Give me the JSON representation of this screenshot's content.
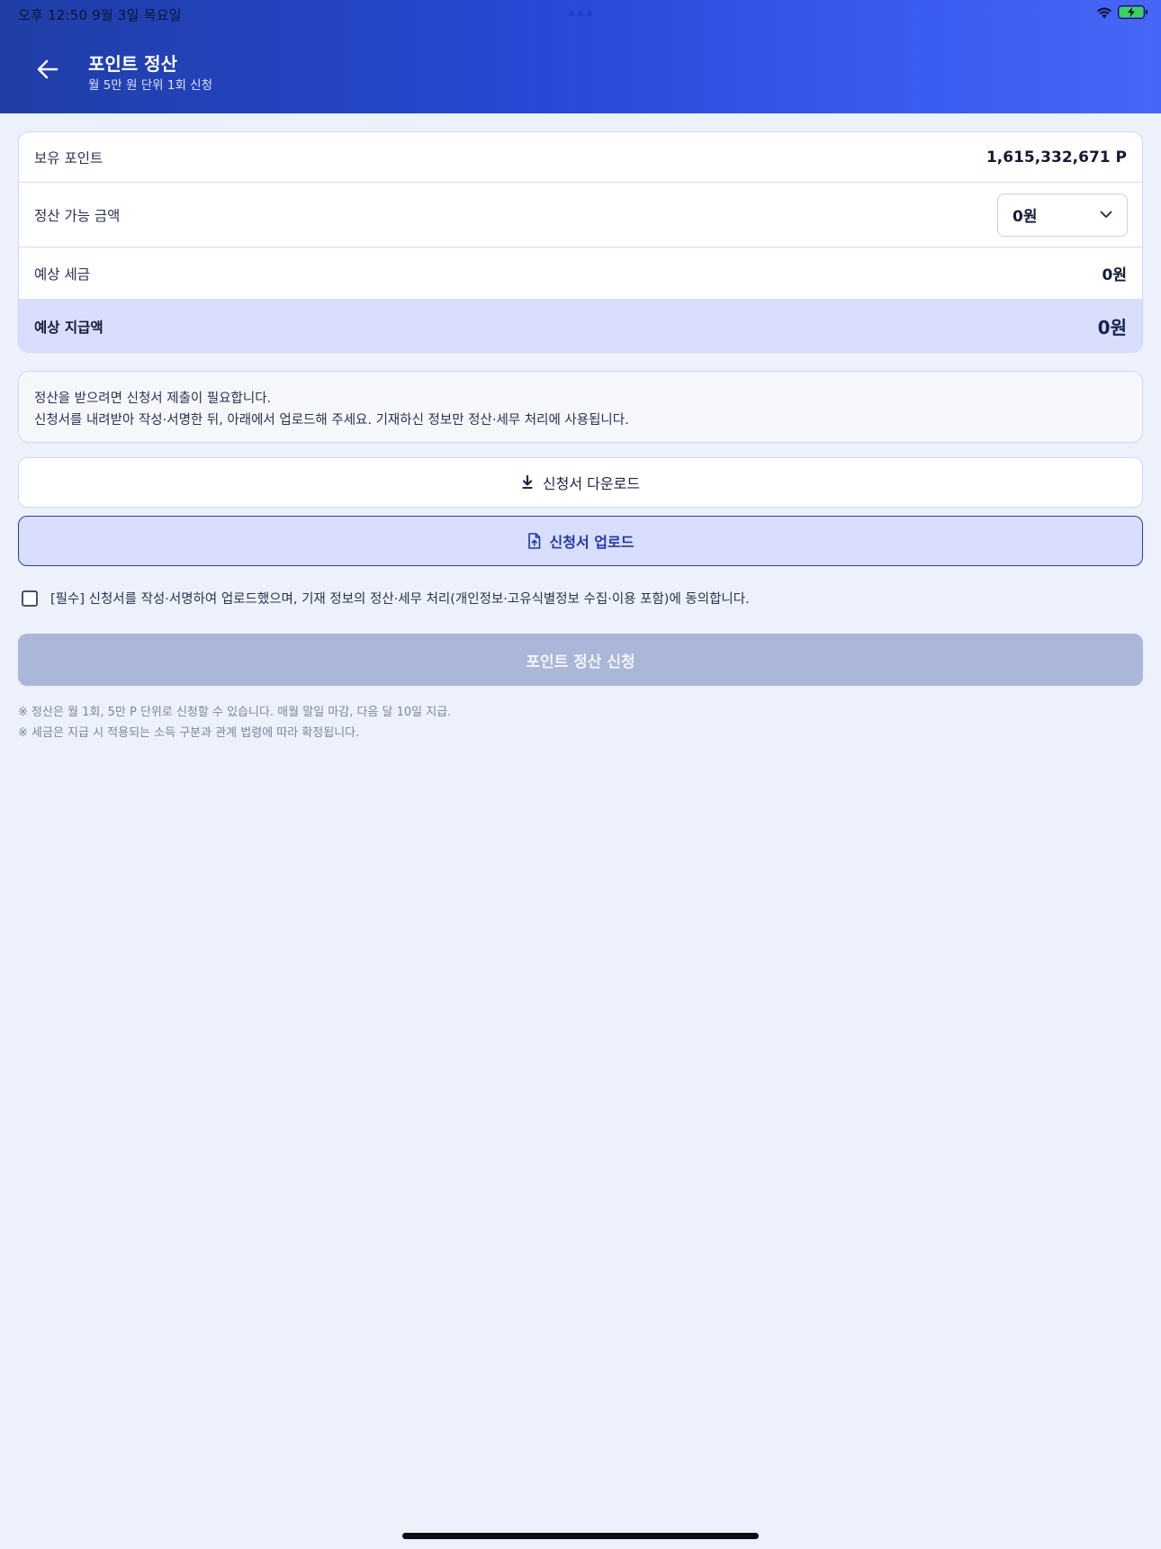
{
  "status_bar": {
    "time": "오후 12:50   9월 3일 목요일"
  },
  "header": {
    "title": "포인트 정산",
    "subtitle": "월 5만 원 단위 1회 신청"
  },
  "summary": {
    "held_points_label": "보유 포인트",
    "held_points_value": "1,615,332,671 P",
    "settleable_label": "정산 가능 금액",
    "settleable_selected": "0원",
    "tax_label": "예상 세금",
    "tax_value": "0원",
    "payout_label": "예상 지급액",
    "payout_value": "0원"
  },
  "notice": {
    "line1": "정산을 받으려면 신청서 제출이 필요합니다.",
    "line2": "신청서를 내려받아 작성·서명한 뒤, 아래에서 업로드해 주세요. 기재하신 정보만 정산·세무 처리에 사용됩니다."
  },
  "actions": {
    "download_label": "신청서 다운로드",
    "upload_label": "신청서 업로드",
    "consent_label": "[필수] 신청서를 작성·서명하여 업로드했으며, 기재 정보의 정산·세무 처리(개인정보·고유식별정보 수집·이용 포함)에 동의합니다.",
    "consent_checked": false,
    "submit_label": "포인트 정산 신청"
  },
  "footnotes": [
    "※ 정산은 월 1회, 5만 P 단위로 신청할 수 있습니다. 매월 말일 마감, 다음 달 10일 지급.",
    "※ 세금은 지급 시 적용되는 소득 구분과 관계 법령에 따라 확정됩니다."
  ],
  "colors": {
    "header_gradient_start": "#1f3ea6",
    "header_gradient_end": "#4766f7",
    "accent": "#2437a3",
    "background": "#edf1fb",
    "disabled_button": "#aab7d8"
  },
  "icons": {
    "back": "arrow-left-icon",
    "dropdown": "chevron-down-icon",
    "download": "download-icon",
    "upload": "file-upload-icon",
    "wifi": "wifi-icon",
    "battery": "battery-charging-icon"
  }
}
